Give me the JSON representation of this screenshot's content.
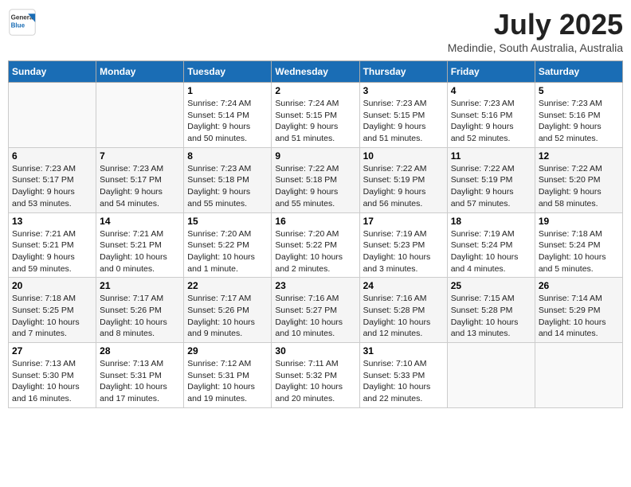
{
  "header": {
    "logo_general": "General",
    "logo_blue": "Blue",
    "title": "July 2025",
    "location": "Medindie, South Australia, Australia"
  },
  "days_of_week": [
    "Sunday",
    "Monday",
    "Tuesday",
    "Wednesday",
    "Thursday",
    "Friday",
    "Saturday"
  ],
  "weeks": [
    [
      {
        "day": "",
        "info": ""
      },
      {
        "day": "",
        "info": ""
      },
      {
        "day": "1",
        "info": "Sunrise: 7:24 AM\nSunset: 5:14 PM\nDaylight: 9 hours\nand 50 minutes."
      },
      {
        "day": "2",
        "info": "Sunrise: 7:24 AM\nSunset: 5:15 PM\nDaylight: 9 hours\nand 51 minutes."
      },
      {
        "day": "3",
        "info": "Sunrise: 7:23 AM\nSunset: 5:15 PM\nDaylight: 9 hours\nand 51 minutes."
      },
      {
        "day": "4",
        "info": "Sunrise: 7:23 AM\nSunset: 5:16 PM\nDaylight: 9 hours\nand 52 minutes."
      },
      {
        "day": "5",
        "info": "Sunrise: 7:23 AM\nSunset: 5:16 PM\nDaylight: 9 hours\nand 52 minutes."
      }
    ],
    [
      {
        "day": "6",
        "info": "Sunrise: 7:23 AM\nSunset: 5:17 PM\nDaylight: 9 hours\nand 53 minutes."
      },
      {
        "day": "7",
        "info": "Sunrise: 7:23 AM\nSunset: 5:17 PM\nDaylight: 9 hours\nand 54 minutes."
      },
      {
        "day": "8",
        "info": "Sunrise: 7:23 AM\nSunset: 5:18 PM\nDaylight: 9 hours\nand 55 minutes."
      },
      {
        "day": "9",
        "info": "Sunrise: 7:22 AM\nSunset: 5:18 PM\nDaylight: 9 hours\nand 55 minutes."
      },
      {
        "day": "10",
        "info": "Sunrise: 7:22 AM\nSunset: 5:19 PM\nDaylight: 9 hours\nand 56 minutes."
      },
      {
        "day": "11",
        "info": "Sunrise: 7:22 AM\nSunset: 5:19 PM\nDaylight: 9 hours\nand 57 minutes."
      },
      {
        "day": "12",
        "info": "Sunrise: 7:22 AM\nSunset: 5:20 PM\nDaylight: 9 hours\nand 58 minutes."
      }
    ],
    [
      {
        "day": "13",
        "info": "Sunrise: 7:21 AM\nSunset: 5:21 PM\nDaylight: 9 hours\nand 59 minutes."
      },
      {
        "day": "14",
        "info": "Sunrise: 7:21 AM\nSunset: 5:21 PM\nDaylight: 10 hours\nand 0 minutes."
      },
      {
        "day": "15",
        "info": "Sunrise: 7:20 AM\nSunset: 5:22 PM\nDaylight: 10 hours\nand 1 minute."
      },
      {
        "day": "16",
        "info": "Sunrise: 7:20 AM\nSunset: 5:22 PM\nDaylight: 10 hours\nand 2 minutes."
      },
      {
        "day": "17",
        "info": "Sunrise: 7:19 AM\nSunset: 5:23 PM\nDaylight: 10 hours\nand 3 minutes."
      },
      {
        "day": "18",
        "info": "Sunrise: 7:19 AM\nSunset: 5:24 PM\nDaylight: 10 hours\nand 4 minutes."
      },
      {
        "day": "19",
        "info": "Sunrise: 7:18 AM\nSunset: 5:24 PM\nDaylight: 10 hours\nand 5 minutes."
      }
    ],
    [
      {
        "day": "20",
        "info": "Sunrise: 7:18 AM\nSunset: 5:25 PM\nDaylight: 10 hours\nand 7 minutes."
      },
      {
        "day": "21",
        "info": "Sunrise: 7:17 AM\nSunset: 5:26 PM\nDaylight: 10 hours\nand 8 minutes."
      },
      {
        "day": "22",
        "info": "Sunrise: 7:17 AM\nSunset: 5:26 PM\nDaylight: 10 hours\nand 9 minutes."
      },
      {
        "day": "23",
        "info": "Sunrise: 7:16 AM\nSunset: 5:27 PM\nDaylight: 10 hours\nand 10 minutes."
      },
      {
        "day": "24",
        "info": "Sunrise: 7:16 AM\nSunset: 5:28 PM\nDaylight: 10 hours\nand 12 minutes."
      },
      {
        "day": "25",
        "info": "Sunrise: 7:15 AM\nSunset: 5:28 PM\nDaylight: 10 hours\nand 13 minutes."
      },
      {
        "day": "26",
        "info": "Sunrise: 7:14 AM\nSunset: 5:29 PM\nDaylight: 10 hours\nand 14 minutes."
      }
    ],
    [
      {
        "day": "27",
        "info": "Sunrise: 7:13 AM\nSunset: 5:30 PM\nDaylight: 10 hours\nand 16 minutes."
      },
      {
        "day": "28",
        "info": "Sunrise: 7:13 AM\nSunset: 5:31 PM\nDaylight: 10 hours\nand 17 minutes."
      },
      {
        "day": "29",
        "info": "Sunrise: 7:12 AM\nSunset: 5:31 PM\nDaylight: 10 hours\nand 19 minutes."
      },
      {
        "day": "30",
        "info": "Sunrise: 7:11 AM\nSunset: 5:32 PM\nDaylight: 10 hours\nand 20 minutes."
      },
      {
        "day": "31",
        "info": "Sunrise: 7:10 AM\nSunset: 5:33 PM\nDaylight: 10 hours\nand 22 minutes."
      },
      {
        "day": "",
        "info": ""
      },
      {
        "day": "",
        "info": ""
      }
    ]
  ]
}
